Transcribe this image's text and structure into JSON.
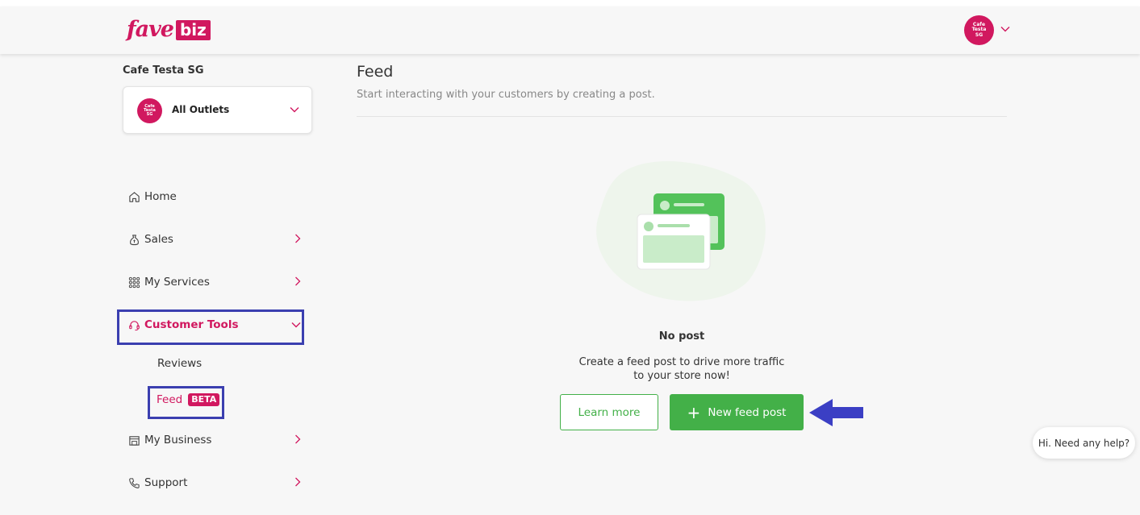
{
  "brand": {
    "logo_text": "fave",
    "logo_badge": "biz",
    "color": "#d1185f"
  },
  "header": {
    "avatar_text": [
      "Cafe",
      "Testa",
      "SG"
    ]
  },
  "sidebar": {
    "business_name": "Cafe Testa SG",
    "outlet": {
      "label": "All Outlets",
      "avatar_text": [
        "Cafe",
        "Testa",
        "SG"
      ]
    },
    "items": [
      {
        "label": "Home",
        "icon": "home-icon"
      },
      {
        "label": "Sales",
        "icon": "money-bag-icon"
      },
      {
        "label": "My Services",
        "icon": "grid-icon"
      },
      {
        "label": "Customer Tools",
        "icon": "headset-icon",
        "expanded": true,
        "children": [
          {
            "label": "Reviews"
          },
          {
            "label": "Feed",
            "badge": "BETA",
            "active": true
          }
        ]
      },
      {
        "label": "My Business",
        "icon": "store-icon"
      },
      {
        "label": "Support",
        "icon": "phone-icon"
      }
    ]
  },
  "main": {
    "title": "Feed",
    "subtitle": "Start interacting with your customers by creating a post.",
    "empty_title": "No post",
    "empty_desc_line1": "Create a feed post to drive more traffic",
    "empty_desc_line2": "to your store now!",
    "learn_more_label": "Learn more",
    "new_post_label": "New feed post"
  },
  "help_widget": {
    "label": "Hi. Need any help?"
  },
  "colors": {
    "accent": "#d1185f",
    "green": "#43b048",
    "annotation": "#3b3fb0"
  }
}
